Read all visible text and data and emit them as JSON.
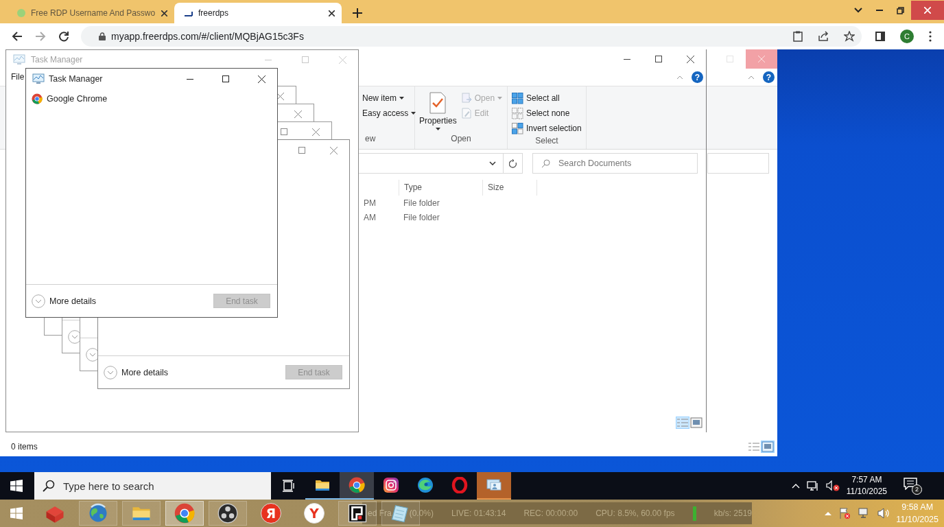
{
  "browser": {
    "tabs": [
      {
        "title": "Free RDP Username And Passwo",
        "selected": false
      },
      {
        "title": "freerdps",
        "selected": true
      }
    ],
    "url": "myapp.freerdps.com/#/client/MQBjAG15c3Fs",
    "profile_initial": "C"
  },
  "explorer_back": {
    "help_glyph": "?",
    "status": "0 items"
  },
  "explorer": {
    "help_glyph": "?",
    "ribbon_groups": [
      {
        "label": "ew",
        "items": [
          {
            "kind": "text-menu",
            "label": "New item",
            "dropdown": true,
            "disabled": false
          },
          {
            "kind": "text-menu",
            "label": "Easy access",
            "dropdown": true,
            "disabled": false
          }
        ]
      },
      {
        "label": "Open",
        "items": [
          {
            "kind": "properties",
            "label": "Properties",
            "dropdown": true,
            "disabled": false
          },
          {
            "kind": "open",
            "label": "Open",
            "dropdown": true,
            "disabled": true
          },
          {
            "kind": "edit",
            "label": "Edit",
            "dropdown": false,
            "disabled": true
          }
        ]
      },
      {
        "label": "Select",
        "items": [
          {
            "kind": "select-all",
            "label": "Select all",
            "dropdown": false,
            "disabled": false
          },
          {
            "kind": "select-none",
            "label": "Select none",
            "dropdown": false,
            "disabled": false
          },
          {
            "kind": "invert-selection",
            "label": "Invert selection",
            "dropdown": false,
            "disabled": false
          }
        ]
      }
    ],
    "search_placeholder": "Search Documents",
    "columns": [
      "Type",
      "Size"
    ],
    "rows": [
      {
        "modified": "PM",
        "type": "File folder"
      },
      {
        "modified": "AM",
        "type": "File folder"
      }
    ]
  },
  "task_manager_back": {
    "title": "Task Manager",
    "menu": [
      "File"
    ]
  },
  "task_manager_behind": {
    "more_details": "More details",
    "end_task": "End task",
    "end_task_disabled": true
  },
  "task_manager": {
    "title": "Task Manager",
    "apps": [
      "Google Chrome"
    ],
    "more_details": "More details",
    "end_task": "End task",
    "end_task_disabled": true
  },
  "remote_taskbar": {
    "search_placeholder": "Type here to search",
    "apps": [
      {
        "kind": "explorer",
        "running": true,
        "selected": false,
        "attention": false
      },
      {
        "kind": "chrome",
        "running": true,
        "selected": true,
        "attention": false
      },
      {
        "kind": "instagram",
        "running": false,
        "selected": false,
        "attention": false
      },
      {
        "kind": "edge",
        "running": false,
        "selected": false,
        "attention": false
      },
      {
        "kind": "opera",
        "running": false,
        "selected": false,
        "attention": false
      },
      {
        "kind": "remote-desktop",
        "running": true,
        "selected": false,
        "attention": true
      }
    ],
    "time": "7:57 AM",
    "date": "11/10/2025",
    "notification_count": "2"
  },
  "host_taskbar": {
    "apps": [
      {
        "kind": "toolbox",
        "running": false,
        "selected": false
      },
      {
        "kind": "globe",
        "running": true,
        "selected": false
      },
      {
        "kind": "explorer",
        "running": true,
        "selected": false
      },
      {
        "kind": "chrome",
        "running": true,
        "selected": true
      },
      {
        "kind": "obs",
        "running": true,
        "selected": false
      },
      {
        "kind": "yandex",
        "glyph": "Я",
        "running": false,
        "selected": false
      },
      {
        "kind": "yandex-browser",
        "glyph": "Y",
        "running": false,
        "selected": false
      },
      {
        "kind": "frame-app",
        "running": true,
        "selected": false
      },
      {
        "kind": "notepad",
        "running": true,
        "selected": false
      }
    ],
    "stats": [
      {
        "kind": "text",
        "text": "ed Fra"
      },
      {
        "kind": "text",
        "text": "(0.0%)"
      },
      {
        "kind": "text",
        "text": "LIVE: 01:43:14"
      },
      {
        "kind": "text",
        "text": "REC: 00:00:00"
      },
      {
        "kind": "text",
        "text": "CPU: 8.5%, 60.00 fps"
      },
      {
        "kind": "meter"
      },
      {
        "kind": "text",
        "text": "kb/s: 2519"
      }
    ],
    "time": "9:58 AM",
    "date": "11/10/2025"
  }
}
